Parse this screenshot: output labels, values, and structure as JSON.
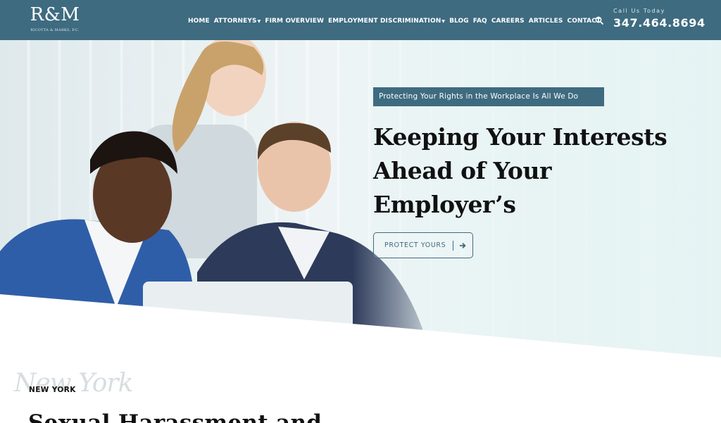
{
  "header": {
    "logo_text": "R&M",
    "logo_subtext": "RICOTTA & MARKS, P.C.",
    "nav": [
      {
        "label": "HOME"
      },
      {
        "label": "ATTORNEYS"
      },
      {
        "label": "FIRM OVERVIEW"
      },
      {
        "label": "EMPLOYMENT DISCRIMINATION"
      },
      {
        "label": "BLOG"
      },
      {
        "label": "FAQ"
      },
      {
        "label": "CAREERS"
      },
      {
        "label": "ARTICLES"
      },
      {
        "label": "CONTACT"
      }
    ],
    "call_label": "Call Us Today",
    "phone": "347.464.8694"
  },
  "hero": {
    "tagline": "Protecting Your Rights in the Workplace Is All We Do",
    "title_lines": [
      "Keeping Your Interests",
      "Ahead of Your",
      "Employer’s"
    ],
    "cta_label": "PROTECT YOURS"
  },
  "section": {
    "script_text": "New York",
    "kicker": "NEW YORK",
    "heading": "Sexual Harassment and"
  },
  "colors": {
    "brand": "#3e6b80",
    "text_dark": "#111111",
    "white": "#ffffff"
  },
  "icons": {
    "search": "search-icon",
    "arrow": "arrow-right-icon",
    "caret": "chevron-down-icon"
  }
}
